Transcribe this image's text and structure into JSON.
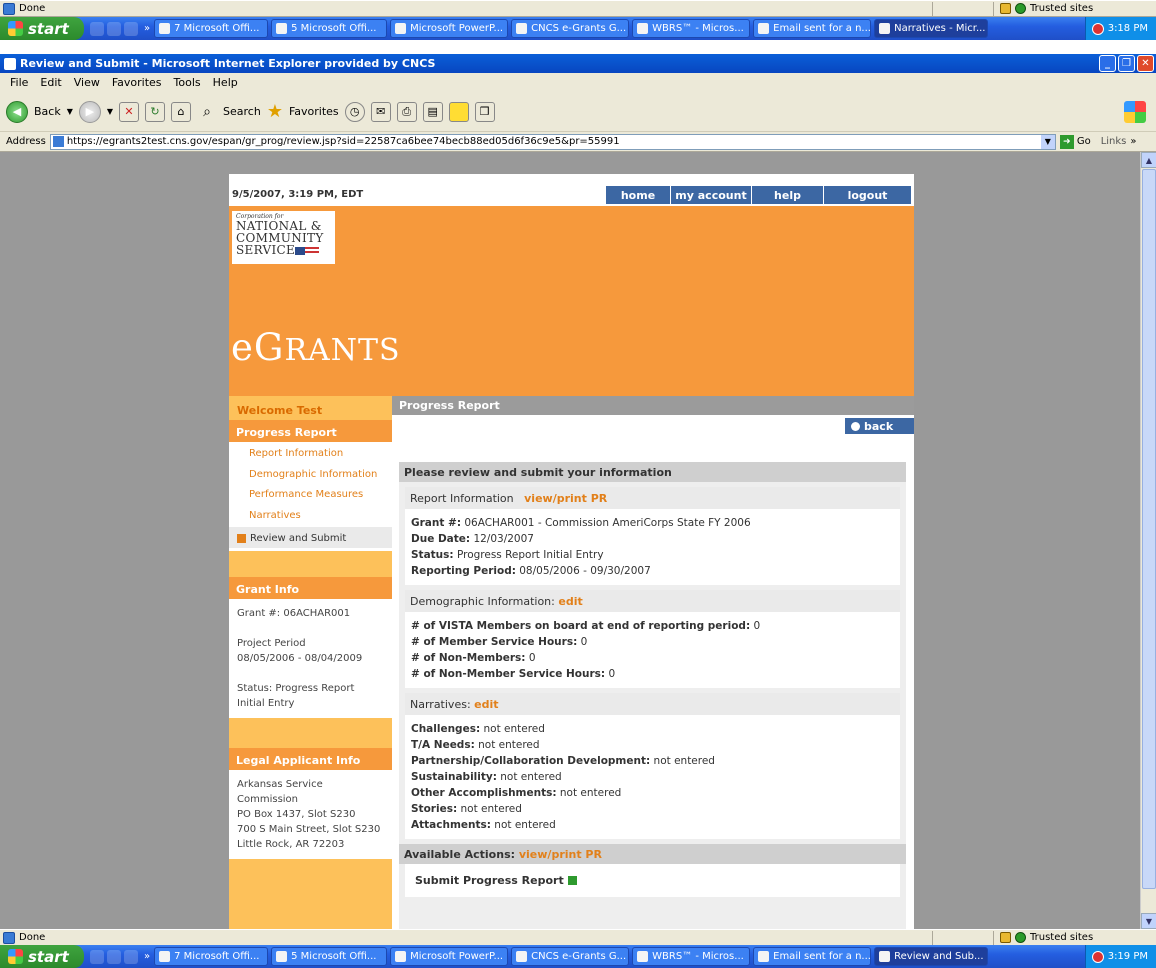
{
  "status": {
    "text": "Done",
    "zone": "Trusted sites"
  },
  "taskbar_top": {
    "start": "start",
    "buttons": [
      "7 Microsoft Offi...",
      "5 Microsoft Offi...",
      "Microsoft PowerP...",
      "CNCS e-Grants G...",
      "WBRS™ - Micros...",
      "Email sent for a n...",
      "Narratives - Micr..."
    ],
    "time": "3:18 PM"
  },
  "taskbar_bottom": {
    "start": "start",
    "buttons": [
      "7 Microsoft Offi...",
      "5 Microsoft Offi...",
      "Microsoft PowerP...",
      "CNCS e-Grants G...",
      "WBRS™ - Micros...",
      "Email sent for a n...",
      "Review and Sub..."
    ],
    "time": "3:19 PM"
  },
  "window": {
    "title": "Review and Submit - Microsoft Internet Explorer provided by CNCS"
  },
  "menu": [
    "File",
    "Edit",
    "View",
    "Favorites",
    "Tools",
    "Help"
  ],
  "toolbar": {
    "back": "Back",
    "search": "Search",
    "favorites": "Favorites"
  },
  "address": {
    "label": "Address",
    "url": "https://egrants2test.cns.gov/espan/gr_prog/review.jsp?sid=22587ca6bee74becb88ed05d6f36c9e5&pr=55991",
    "go": "Go",
    "links": "Links"
  },
  "page": {
    "datetime": "9/5/2007, 3:19 PM, EDT",
    "nav": [
      "home",
      "my account",
      "help",
      "logout"
    ],
    "logo": {
      "small": "Corporation for",
      "line1": "NATIONAL &",
      "line2": "COMMUNITY",
      "line3": "SERVICE"
    },
    "brand": {
      "e": "e",
      "g": "G",
      "rest": "RANTS"
    },
    "sidebar": {
      "welcome": "Welcome Test",
      "progress_title": "Progress Report",
      "links": [
        "Report Information",
        "Demographic Information",
        "Performance Measures",
        "Narratives"
      ],
      "current": "Review and Submit",
      "grant_title": "Grant Info",
      "grant_num": "Grant #: 06ACHAR001",
      "period_label": "Project Period",
      "period": "08/05/2006 - 08/04/2009",
      "status1": "Status: Progress Report",
      "status2": "Initial Entry",
      "legal_title": "Legal Applicant Info",
      "legal": [
        "Arkansas Service",
        "Commission",
        "PO Box 1437, Slot S230",
        "700 S Main Street, Slot S230",
        "Little Rock, AR 72203"
      ]
    },
    "main": {
      "title": "Progress Report",
      "back": "back",
      "review_title": "Please review and submit your information",
      "report": {
        "head": "Report Information",
        "link": "view/print PR",
        "fields": [
          {
            "k": "Grant #:",
            "v": " 06ACHAR001 - Commission AmeriCorps State FY 2006"
          },
          {
            "k": "Due Date:",
            "v": " 12/03/2007"
          },
          {
            "k": "Status:",
            "v": " Progress Report Initial Entry"
          },
          {
            "k": "Reporting Period:",
            "v": " 08/05/2006 - 09/30/2007"
          }
        ]
      },
      "demo": {
        "head": "Demographic Information:",
        "link": "edit",
        "fields": [
          {
            "k": "# of VISTA Members on board at end of reporting period:",
            "v": " 0"
          },
          {
            "k": "# of Member Service Hours:",
            "v": " 0"
          },
          {
            "k": "# of Non-Members:",
            "v": " 0"
          },
          {
            "k": "# of Non-Member Service Hours:",
            "v": " 0"
          }
        ]
      },
      "narr": {
        "head": "Narratives:",
        "link": "edit",
        "fields": [
          {
            "k": "Challenges:",
            "v": " not entered"
          },
          {
            "k": "T/A Needs:",
            "v": " not entered"
          },
          {
            "k": "Partnership/Collaboration Development:",
            "v": " not entered"
          },
          {
            "k": "Sustainability:",
            "v": " not entered"
          },
          {
            "k": "Other Accomplishments:",
            "v": " not entered"
          },
          {
            "k": "Stories:",
            "v": " not entered"
          },
          {
            "k": "Attachments:",
            "v": " not entered"
          }
        ]
      },
      "actions": {
        "label": "Available Actions:",
        "link": "view/print PR"
      },
      "submit": "Submit Progress Report"
    }
  }
}
